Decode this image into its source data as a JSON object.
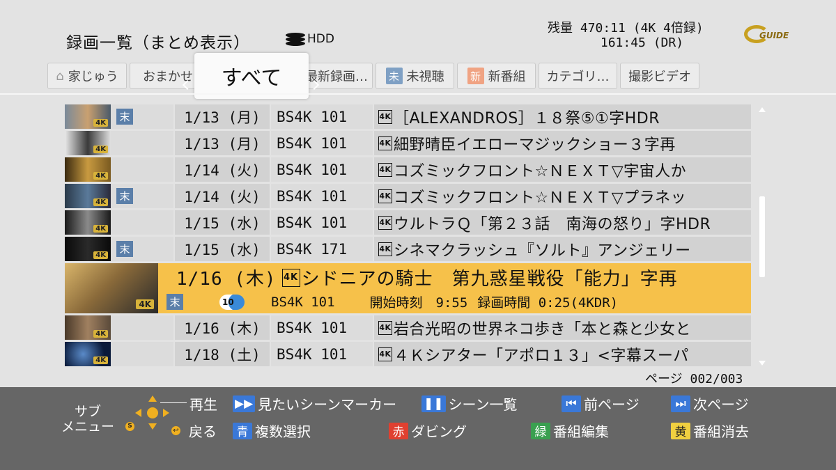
{
  "header": {
    "title": "録画一覧（まとめ表示）",
    "device": "HDD",
    "remaining": "残量 470:11 (4K 4倍録)\n       161:45 (DR)",
    "logo": "GUIDE"
  },
  "tabs": [
    {
      "label": "家じゅう",
      "icon": "house-icon"
    },
    {
      "label": "おまかせ"
    },
    {
      "label": "最新録画…"
    },
    {
      "label": "未視聴",
      "badge": "未",
      "badge_color": "#7fa0c4"
    },
    {
      "label": "新番組",
      "badge": "新",
      "badge_color": "#f0a383"
    },
    {
      "label": "カテゴリ…"
    },
    {
      "label": "撮影ビデオ"
    }
  ],
  "selected_tab": "すべて",
  "rows": [
    {
      "unwatched": "末",
      "date": "1/13 (月)",
      "channel": "BS4K 101",
      "mark": "4K",
      "title": "［ALEXANDROS］１８祭⑤①字HDR"
    },
    {
      "unwatched": "",
      "date": "1/13 (月)",
      "channel": "BS4K 101",
      "mark": "4K",
      "title": "細野晴臣イエローマジックショー３字再"
    },
    {
      "unwatched": "",
      "date": "1/14 (火)",
      "channel": "BS4K 101",
      "mark": "4K",
      "title": "コズミックフロント☆ＮＥＸＴ▽宇宙人か"
    },
    {
      "unwatched": "末",
      "date": "1/14 (火)",
      "channel": "BS4K 101",
      "mark": "4K",
      "title": "コズミックフロント☆ＮＥＸＴ▽プラネッ"
    },
    {
      "unwatched": "",
      "date": "1/15 (水)",
      "channel": "BS4K 101",
      "mark": "4K",
      "title": "ウルトラＱ「第２３話　南海の怒り」字HDR"
    },
    {
      "unwatched": "末",
      "date": "1/15 (水)",
      "channel": "BS4K 171",
      "mark": "4K",
      "title": "シネマクラッシュ『ソルト』アンジェリー"
    }
  ],
  "selected_row": {
    "date": "1/16 (木)",
    "mark": "4K",
    "title": "シドニアの騎士　第九惑星戦役「能力」字再",
    "unwatched": "末",
    "skip_badge": "10",
    "channel": "BS4K 101",
    "start": "開始時刻　9:55",
    "duration": "録画時間 0:25(4KDR)"
  },
  "rows_after": [
    {
      "unwatched": "",
      "date": "1/16 (木)",
      "channel": "BS4K 101",
      "mark": "4K",
      "title": "岩合光昭の世界ネコ歩き「本と森と少女と"
    },
    {
      "unwatched": "",
      "date": "1/18 (土)",
      "channel": "BS4K 101",
      "mark": "4K",
      "title": "４Ｋシアター「アポロ１３」<字幕スーパ"
    }
  ],
  "page": "ページ 002/003",
  "footer": {
    "sub_menu": "サブ\nメニュー",
    "play": "再生",
    "back": "戻る",
    "scene_marker": "見たいシーンマーカー",
    "scene_list": "シーン一覧",
    "prev_page": "前ページ",
    "next_page": "次ページ",
    "blue_badge": "青",
    "blue_label": "複数選択",
    "red_badge": "赤",
    "red_label": "ダビング",
    "green_badge": "緑",
    "green_label": "番組編集",
    "yellow_badge": "黄",
    "yellow_label": "番組消去"
  },
  "colors": {
    "blue": "#3a78d8",
    "red": "#e04030",
    "green": "#3aa050",
    "yellow": "#f0d040",
    "highlight": "#f6c14a"
  }
}
